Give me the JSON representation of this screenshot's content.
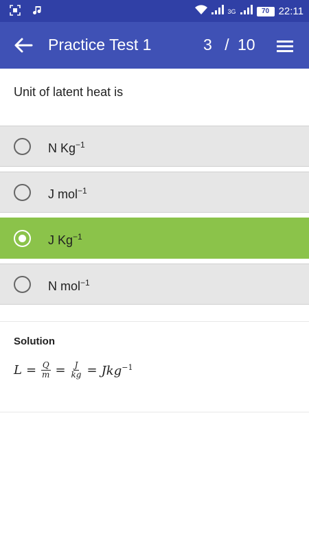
{
  "status_bar": {
    "time": "22:11",
    "battery": "70",
    "network_label": "3G"
  },
  "app_bar": {
    "title": "Practice Test 1",
    "current": "3",
    "separator": "/",
    "total": "10"
  },
  "question": "Unit of latent heat is",
  "options": [
    {
      "base": "N Kg",
      "exp": "−1",
      "selected": false
    },
    {
      "base": "J mol",
      "exp": "−1",
      "selected": false
    },
    {
      "base": "J Kg",
      "exp": "−1",
      "selected": true
    },
    {
      "base": "N mol",
      "exp": "−1",
      "selected": false
    }
  ],
  "solution": {
    "title": "Solution",
    "formula": {
      "lhs": "L",
      "frac1_num": "Q",
      "frac1_den": "m",
      "frac2_num": "J",
      "frac2_den": "kg",
      "rhs_base": "Jkg",
      "rhs_exp": "−1"
    }
  },
  "colors": {
    "status_bar": "#3040a6",
    "app_bar": "#3f51b5",
    "option_bg": "#e6e6e6",
    "selected_bg": "#8bc34a"
  }
}
